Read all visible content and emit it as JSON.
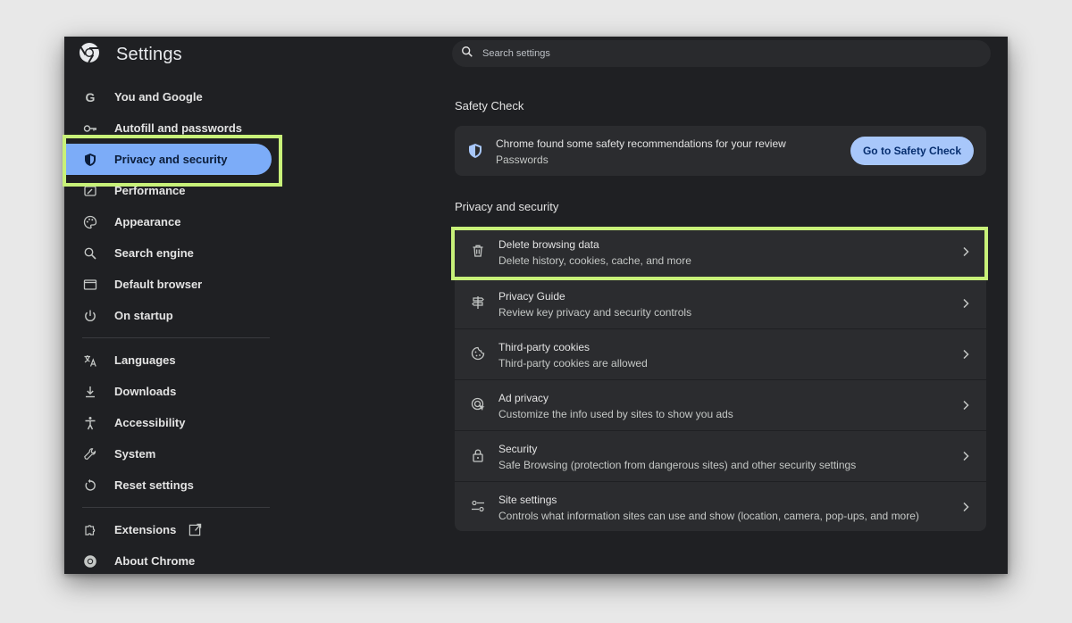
{
  "app": {
    "title": "Settings",
    "logo_icon": "chrome-logo-icon"
  },
  "search": {
    "placeholder": "Search settings",
    "icon": "search-icon"
  },
  "sidebar": {
    "items": [
      {
        "label": "You and Google",
        "icon": "google-g-icon",
        "active": false
      },
      {
        "label": "Autofill and passwords",
        "icon": "key-icon",
        "active": false
      },
      {
        "label": "Privacy and security",
        "icon": "shield-icon",
        "active": true
      },
      {
        "label": "Performance",
        "icon": "speedometer-icon",
        "active": false
      },
      {
        "label": "Appearance",
        "icon": "palette-icon",
        "active": false
      },
      {
        "label": "Search engine",
        "icon": "search-icon",
        "active": false
      },
      {
        "label": "Default browser",
        "icon": "browser-window-icon",
        "active": false
      },
      {
        "label": "On startup",
        "icon": "power-icon",
        "active": false
      },
      {
        "label": "Languages",
        "icon": "translate-icon",
        "active": false
      },
      {
        "label": "Downloads",
        "icon": "download-icon",
        "active": false
      },
      {
        "label": "Accessibility",
        "icon": "accessibility-icon",
        "active": false
      },
      {
        "label": "System",
        "icon": "wrench-icon",
        "active": false
      },
      {
        "label": "Reset settings",
        "icon": "reset-icon",
        "active": false
      },
      {
        "label": "Extensions",
        "icon": "puzzle-icon",
        "active": false,
        "external_icon": "open-in-new-icon"
      },
      {
        "label": "About Chrome",
        "icon": "chrome-logo-icon",
        "active": false
      }
    ]
  },
  "safety_check": {
    "heading": "Safety Check",
    "title": "Chrome found some safety recommendations for your review",
    "subtitle": "Passwords",
    "button_label": "Go to Safety Check",
    "icon": "shield-check-icon"
  },
  "privacy": {
    "heading": "Privacy and security",
    "rows": [
      {
        "title": "Delete browsing data",
        "subtitle": "Delete history, cookies, cache, and more",
        "icon": "trash-icon",
        "highlighted": true
      },
      {
        "title": "Privacy Guide",
        "subtitle": "Review key privacy and security controls",
        "icon": "signpost-icon",
        "highlighted": false
      },
      {
        "title": "Third-party cookies",
        "subtitle": "Third-party cookies are allowed",
        "icon": "cookie-icon",
        "highlighted": false
      },
      {
        "title": "Ad privacy",
        "subtitle": "Customize the info used by sites to show you ads",
        "icon": "ad-privacy-icon",
        "highlighted": false
      },
      {
        "title": "Security",
        "subtitle": "Safe Browsing (protection from dangerous sites) and other security settings",
        "icon": "lock-icon",
        "highlighted": false
      },
      {
        "title": "Site settings",
        "subtitle": "Controls what information sites can use and show (location, camera, pop-ups, and more)",
        "icon": "sliders-icon",
        "highlighted": false
      }
    ]
  },
  "colors": {
    "window_bg": "#1f2023",
    "card_bg": "#2b2c2f",
    "active_nav_bg": "#7cacf8",
    "button_bg": "#a8c7fa",
    "highlight_box": "#c8f179"
  }
}
